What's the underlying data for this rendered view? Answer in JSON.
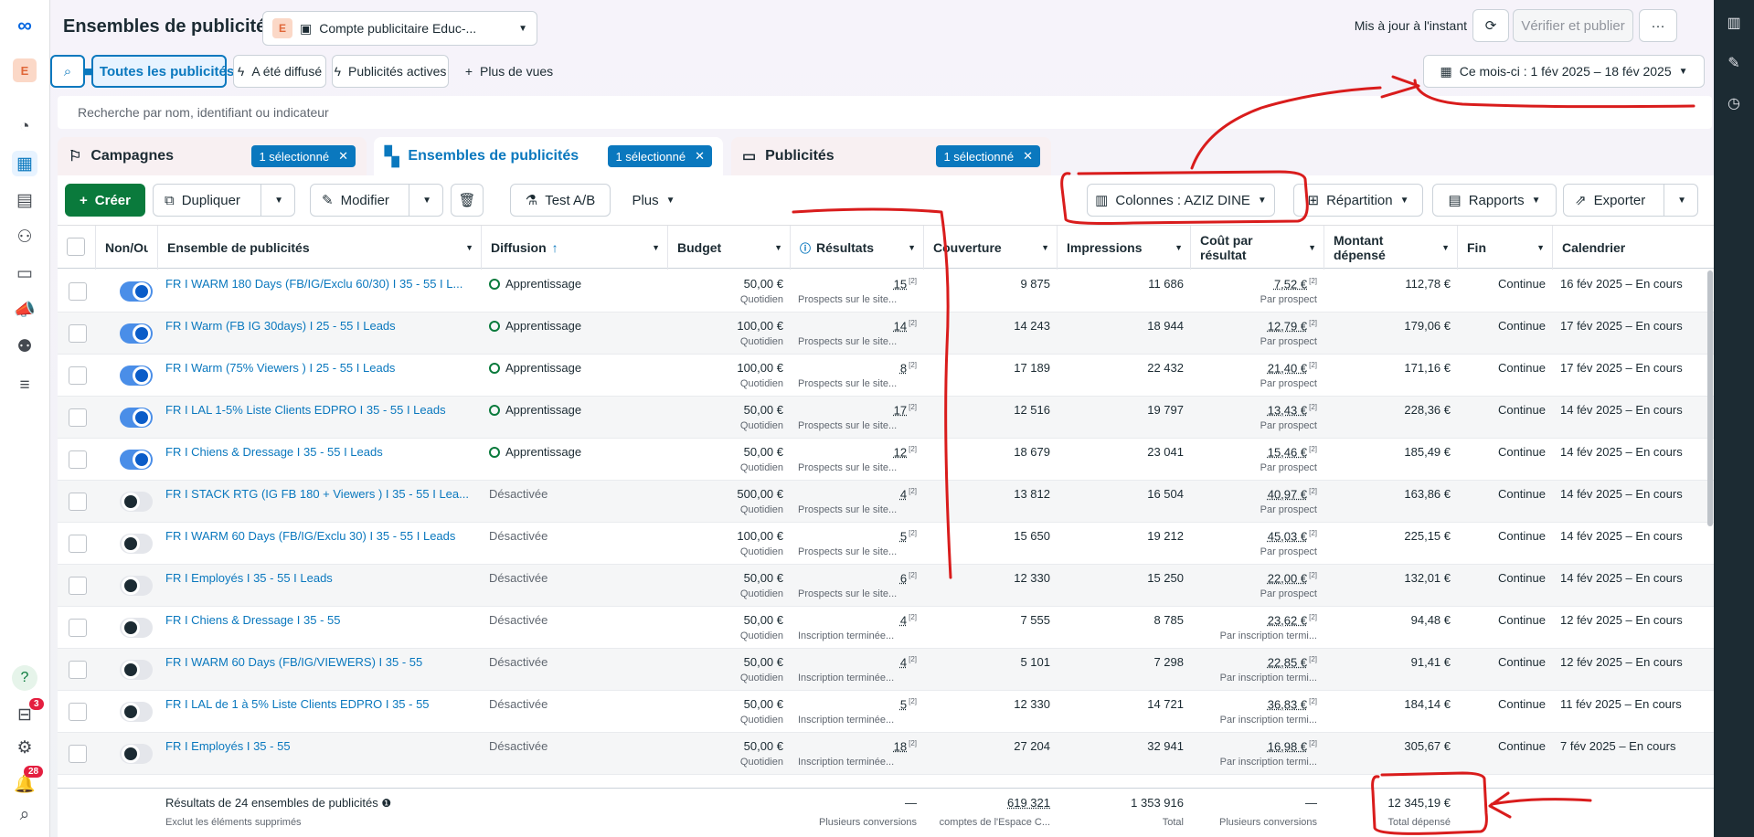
{
  "page_title": "Ensembles de publicités",
  "account": {
    "letter": "E",
    "name": "Compte publicitaire Educ-..."
  },
  "header": {
    "updated": "Mis à jour à l'instant",
    "verify_label": "Vérifier et publier",
    "more_label": "···"
  },
  "views": {
    "all": "Toutes les publicités",
    "delivered": "A été diffusé",
    "active": "Publicités actives",
    "more": "Plus de vues"
  },
  "date_range": "Ce mois-ci : 1 fév 2025 – 18 fév 2025",
  "search": {
    "placeholder": "Recherche par nom, identifiant ou indicateur"
  },
  "levels": {
    "campaigns": "Campagnes",
    "adsets": "Ensembles de publicités",
    "ads": "Publicités",
    "selected": "1 sélectionné"
  },
  "toolbar": {
    "create": "Créer",
    "duplicate": "Dupliquer",
    "edit": "Modifier",
    "abtest": "Test A/B",
    "more": "Plus",
    "columns": "Colonnes : AZIZ DINE",
    "breakdown": "Répartition",
    "reports": "Rapports",
    "export": "Exporter"
  },
  "columns": {
    "onoff": "Non/Ou",
    "name": "Ensemble de publicités",
    "delivery": "Diffusion",
    "budget": "Budget",
    "results": "Résultats",
    "reach": "Couverture",
    "impressions": "Impressions",
    "cpr": "Coût par résultat",
    "spent": "Montant dépensé",
    "end": "Fin",
    "schedule": "Calendrier"
  },
  "rows": [
    {
      "on": true,
      "name": "FR I WARM 180 Days (FB/IG/Exclu 60/30) I 35 - 55 I L...",
      "delivery": "Apprentissage",
      "budget": "50,00 €",
      "budget_type": "Quotidien",
      "results": "15",
      "results_type": "Prospects sur le site...",
      "reach": "9 875",
      "impressions": "11 686",
      "cpr": "7,52 €",
      "cpr_type": "Par prospect",
      "spent": "112,78 €",
      "end": "Continue",
      "schedule": "16 fév 2025 – En cours"
    },
    {
      "on": true,
      "name": "FR I Warm (FB IG 30days) I 25 - 55 I Leads",
      "delivery": "Apprentissage",
      "budget": "100,00 €",
      "budget_type": "Quotidien",
      "results": "14",
      "results_type": "Prospects sur le site...",
      "reach": "14 243",
      "impressions": "18 944",
      "cpr": "12,79 €",
      "cpr_type": "Par prospect",
      "spent": "179,06 €",
      "end": "Continue",
      "schedule": "17 fév 2025 – En cours"
    },
    {
      "on": true,
      "name": "FR I Warm (75% Viewers ) I 25 - 55 I Leads",
      "delivery": "Apprentissage",
      "budget": "100,00 €",
      "budget_type": "Quotidien",
      "results": "8",
      "results_type": "Prospects sur le site...",
      "reach": "17 189",
      "impressions": "22 432",
      "cpr": "21,40 €",
      "cpr_type": "Par prospect",
      "spent": "171,16 €",
      "end": "Continue",
      "schedule": "17 fév 2025 – En cours"
    },
    {
      "on": true,
      "name": "FR I LAL 1-5% Liste Clients EDPRO I 35 - 55 I Leads",
      "delivery": "Apprentissage",
      "budget": "50,00 €",
      "budget_type": "Quotidien",
      "results": "17",
      "results_type": "Prospects sur le site...",
      "reach": "12 516",
      "impressions": "19 797",
      "cpr": "13,43 €",
      "cpr_type": "Par prospect",
      "spent": "228,36 €",
      "end": "Continue",
      "schedule": "14 fév 2025 – En cours"
    },
    {
      "on": true,
      "name": "FR I Chiens & Dressage I 35 - 55 I Leads",
      "delivery": "Apprentissage",
      "budget": "50,00 €",
      "budget_type": "Quotidien",
      "results": "12",
      "results_type": "Prospects sur le site...",
      "reach": "18 679",
      "impressions": "23 041",
      "cpr": "15,46 €",
      "cpr_type": "Par prospect",
      "spent": "185,49 €",
      "end": "Continue",
      "schedule": "14 fév 2025 – En cours"
    },
    {
      "on": false,
      "name": "FR I STACK RTG (IG FB 180 + Viewers ) I 35 - 55 I Lea...",
      "delivery": "Désactivée",
      "budget": "500,00 €",
      "budget_type": "Quotidien",
      "results": "4",
      "results_type": "Prospects sur le site...",
      "reach": "13 812",
      "impressions": "16 504",
      "cpr": "40,97 €",
      "cpr_type": "Par prospect",
      "spent": "163,86 €",
      "end": "Continue",
      "schedule": "14 fév 2025 – En cours"
    },
    {
      "on": false,
      "name": "FR I WARM 60 Days (FB/IG/Exclu 30) I 35 - 55 I Leads",
      "delivery": "Désactivée",
      "budget": "100,00 €",
      "budget_type": "Quotidien",
      "results": "5",
      "results_type": "Prospects sur le site...",
      "reach": "15 650",
      "impressions": "19 212",
      "cpr": "45,03 €",
      "cpr_type": "Par prospect",
      "spent": "225,15 €",
      "end": "Continue",
      "schedule": "14 fév 2025 – En cours"
    },
    {
      "on": false,
      "name": "FR I Employés I 35 - 55 I Leads",
      "delivery": "Désactivée",
      "budget": "50,00 €",
      "budget_type": "Quotidien",
      "results": "6",
      "results_type": "Prospects sur le site...",
      "reach": "12 330",
      "impressions": "15 250",
      "cpr": "22,00 €",
      "cpr_type": "Par prospect",
      "spent": "132,01 €",
      "end": "Continue",
      "schedule": "14 fév 2025 – En cours"
    },
    {
      "on": false,
      "name": "FR I Chiens & Dressage I 35 - 55",
      "delivery": "Désactivée",
      "budget": "50,00 €",
      "budget_type": "Quotidien",
      "results": "4",
      "results_type": "Inscription terminée...",
      "reach": "7 555",
      "impressions": "8 785",
      "cpr": "23,62 €",
      "cpr_type": "Par inscription termi...",
      "spent": "94,48 €",
      "end": "Continue",
      "schedule": "12 fév 2025 – En cours"
    },
    {
      "on": false,
      "name": "FR I WARM 60 Days (FB/IG/VIEWERS) I 35 - 55",
      "delivery": "Désactivée",
      "budget": "50,00 €",
      "budget_type": "Quotidien",
      "results": "4",
      "results_type": "Inscription terminée...",
      "reach": "5 101",
      "impressions": "7 298",
      "cpr": "22,85 €",
      "cpr_type": "Par inscription termi...",
      "spent": "91,41 €",
      "end": "Continue",
      "schedule": "12 fév 2025 – En cours"
    },
    {
      "on": false,
      "name": "FR I LAL de 1 à 5% Liste Clients EDPRO I 35 - 55",
      "delivery": "Désactivée",
      "budget": "50,00 €",
      "budget_type": "Quotidien",
      "results": "5",
      "results_type": "Inscription terminée...",
      "reach": "12 330",
      "impressions": "14 721",
      "cpr": "36,83 €",
      "cpr_type": "Par inscription termi...",
      "spent": "184,14 €",
      "end": "Continue",
      "schedule": "11 fév 2025 – En cours"
    },
    {
      "on": false,
      "name": "FR I Employés I 35 - 55",
      "delivery": "Désactivée",
      "budget": "50,00 €",
      "budget_type": "Quotidien",
      "results": "18",
      "results_type": "Inscription terminée...",
      "reach": "27 204",
      "impressions": "32 941",
      "cpr": "16,98 €",
      "cpr_type": "Par inscription termi...",
      "spent": "305,67 €",
      "end": "Continue",
      "schedule": "7 fév 2025 – En cours"
    }
  ],
  "footer": {
    "label": "Résultats de 24 ensembles de publicités",
    "sublabel": "Exclut les éléments supprimés",
    "results": "—",
    "results_sub": "Plusieurs conversions",
    "reach": "619 321",
    "reach_sub": "comptes de l'Espace C...",
    "impressions": "1 353 916",
    "impressions_sub": "Total",
    "cpr": "—",
    "cpr_sub": "Plusieurs conversions",
    "spent": "12 345,19 €",
    "spent_sub": "Total dépensé"
  },
  "rail_badges": {
    "notifications": "3",
    "alerts": "28"
  },
  "colors": {
    "accent": "#0a78be",
    "create": "#0a7a3c",
    "annotation": "#d91c1c",
    "learning": "#0a7a3c"
  }
}
